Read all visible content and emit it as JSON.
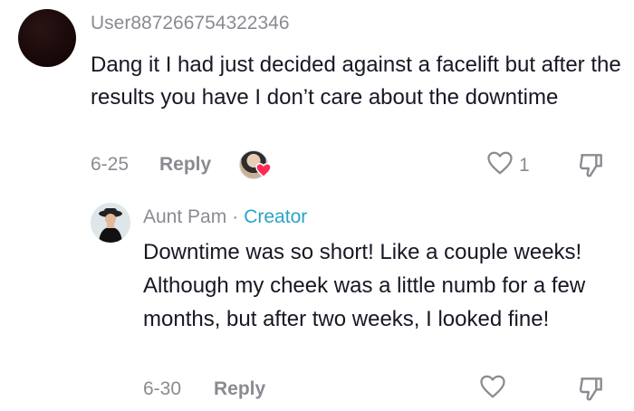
{
  "comment": {
    "username": "User887266754322346",
    "text": "Dang it I had just decided against a facelift but after the results you have I don’t care about the downtime",
    "date": "6-25",
    "reply_label": "Reply",
    "like_count": "1"
  },
  "reply": {
    "author": "Aunt Pam",
    "separator": "·",
    "badge": "Creator",
    "text": "Downtime was so short! Like a couple weeks! Although my cheek was a little numb for a few months, but after two weeks, I looked fine!",
    "date": "6-30",
    "reply_label": "Reply"
  },
  "colors": {
    "muted": "#8a8b91",
    "creator": "#2aa3c7",
    "heart_badge": "#fe2c55"
  }
}
